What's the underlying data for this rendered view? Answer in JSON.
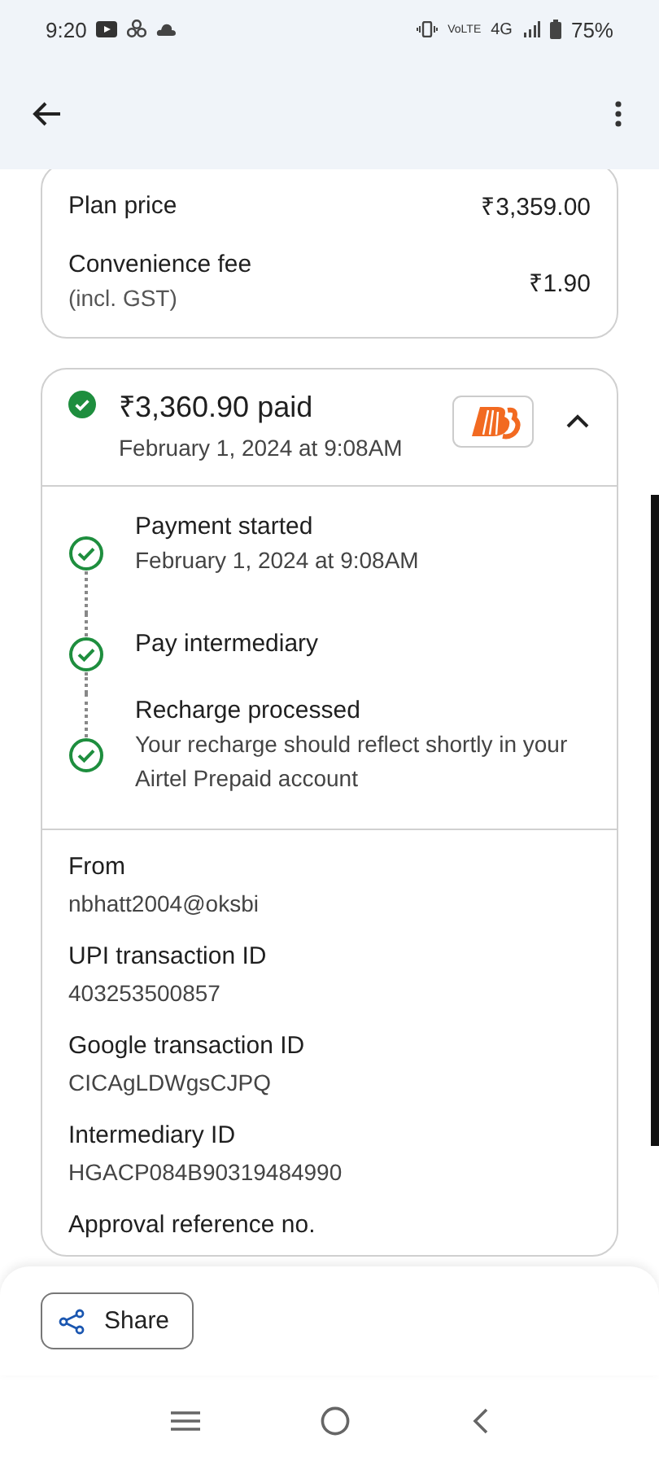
{
  "status_bar": {
    "time": "9:20",
    "network_badge": "VoLTE",
    "network": "4G",
    "battery": "75%"
  },
  "fees": [
    {
      "label": "Plan price",
      "amount": "₹3,359.00"
    },
    {
      "label": "Convenience fee",
      "note": "(incl. GST)",
      "amount": "₹1.90"
    }
  ],
  "payment": {
    "amount": "₹3,360.90 paid",
    "date": "February 1, 2024 at 9:08AM",
    "expanded": true
  },
  "steps": [
    {
      "title": "Payment started",
      "detail": "February 1, 2024 at 9:08AM"
    },
    {
      "title": "Pay intermediary"
    },
    {
      "title": "Recharge processed",
      "detail": "Your recharge should reflect shortly in your Airtel Prepaid account"
    }
  ],
  "details": [
    {
      "label": "From",
      "value": "nbhatt2004@oksbi"
    },
    {
      "label": "UPI transaction ID",
      "value": "403253500857"
    },
    {
      "label": "Google transaction ID",
      "value": "CICAgLDWgsCJPQ"
    },
    {
      "label": "Intermediary ID",
      "value": "HGACP084B90319484990"
    },
    {
      "label": "Approval reference no."
    }
  ],
  "share_button": "Share"
}
